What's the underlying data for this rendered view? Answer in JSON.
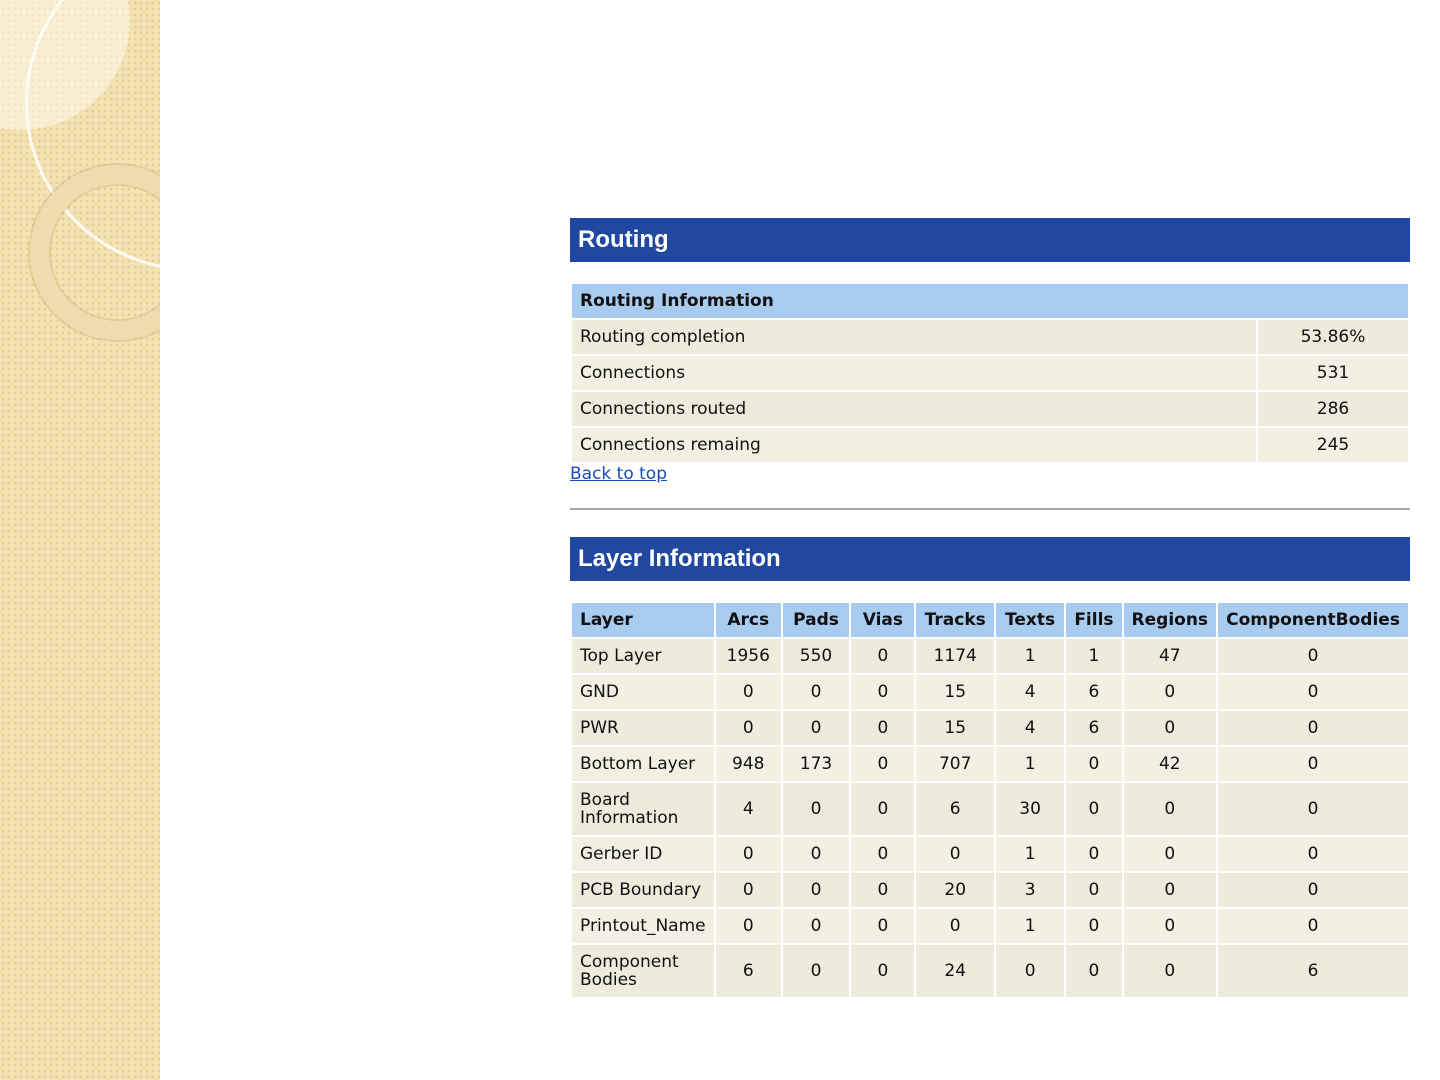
{
  "routing": {
    "heading": "Routing",
    "table_title": "Routing Information",
    "rows": [
      {
        "label": "Routing completion",
        "value": "53.86%"
      },
      {
        "label": "Connections",
        "value": "531"
      },
      {
        "label": "Connections routed",
        "value": "286"
      },
      {
        "label": "Connections remaing",
        "value": "245"
      }
    ],
    "back_link": "Back to top"
  },
  "layers": {
    "heading": "Layer Information",
    "columns": [
      "Layer",
      "Arcs",
      "Pads",
      "Vias",
      "Tracks",
      "Texts",
      "Fills",
      "Regions",
      "ComponentBodies"
    ],
    "rows": [
      [
        "Top Layer",
        "1956",
        "550",
        "0",
        "1174",
        "1",
        "1",
        "47",
        "0"
      ],
      [
        "GND",
        "0",
        "0",
        "0",
        "15",
        "4",
        "6",
        "0",
        "0"
      ],
      [
        "PWR",
        "0",
        "0",
        "0",
        "15",
        "4",
        "6",
        "0",
        "0"
      ],
      [
        "Bottom Layer",
        "948",
        "173",
        "0",
        "707",
        "1",
        "0",
        "42",
        "0"
      ],
      [
        "Board Information",
        "4",
        "0",
        "0",
        "6",
        "30",
        "0",
        "0",
        "0"
      ],
      [
        "Gerber ID",
        "0",
        "0",
        "0",
        "0",
        "1",
        "0",
        "0",
        "0"
      ],
      [
        "PCB Boundary",
        "0",
        "0",
        "0",
        "20",
        "3",
        "0",
        "0",
        "0"
      ],
      [
        "Printout_Name",
        "0",
        "0",
        "0",
        "0",
        "1",
        "0",
        "0",
        "0"
      ],
      [
        "Component Bodies",
        "6",
        "0",
        "0",
        "24",
        "0",
        "0",
        "0",
        "6"
      ]
    ]
  }
}
